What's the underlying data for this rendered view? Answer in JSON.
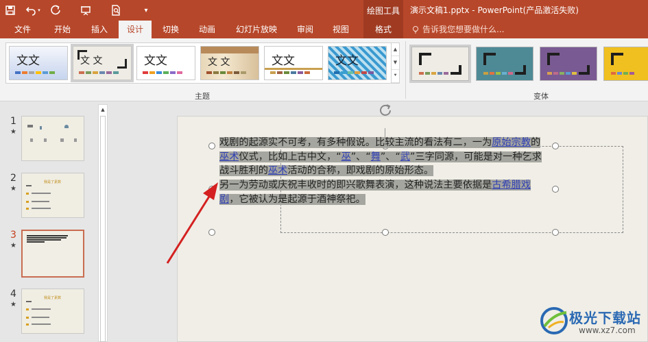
{
  "title_bar": {
    "context_tools": "绘图工具",
    "document_title": "演示文稿1.pptx - PowerPoint(产品激活失败)"
  },
  "tabs": [
    {
      "label": "文件",
      "active": false
    },
    {
      "label": "开始",
      "active": false
    },
    {
      "label": "插入",
      "active": false
    },
    {
      "label": "设计",
      "active": true
    },
    {
      "label": "切换",
      "active": false
    },
    {
      "label": "动画",
      "active": false
    },
    {
      "label": "幻灯片放映",
      "active": false
    },
    {
      "label": "审阅",
      "active": false
    },
    {
      "label": "视图",
      "active": false
    },
    {
      "label": "格式",
      "active": false
    }
  ],
  "tell_me": "告诉我您想要做什么...",
  "ribbon": {
    "themes_group_label": "主题",
    "variants_group_label": "变体",
    "theme_sample_text": "文文",
    "theme_sample_text_spaced": "文 文"
  },
  "slides": [
    {
      "number": "1"
    },
    {
      "number": "2",
      "title": "我是了素数"
    },
    {
      "number": "3"
    },
    {
      "number": "4",
      "title": "我是了素数"
    }
  ],
  "slide_text": {
    "p1_a": "戏剧的起源实不可考，有多种假说。比较主流的看法有二，一为",
    "p1_link1": "原始宗教",
    "p1_b": "的",
    "p1_link2": "巫术",
    "p1_c": "仪式，比如上古中文，“",
    "p1_link3": "巫",
    "p1_d": "”、“",
    "p1_link4": "舞",
    "p1_e": "”、“",
    "p1_link5": "武",
    "p1_f": "”三字同源，可能是对一种乞求战斗胜利的",
    "p1_link6": "巫术",
    "p1_g": "活动的合称，即戏剧的原始形态。",
    "p2_a": "另一为劳动或庆祝丰收时的即兴歌舞表演，这种说法主要依据是",
    "p2_link1": "古希腊戏剧",
    "p2_b": "，它被认为是起源于酒神祭祀。"
  },
  "watermark": {
    "name": "极光下载站",
    "url": "www.xz7.com"
  },
  "colors": {
    "accent": "#b7472a",
    "ribbon_bg": "#f3f3f3",
    "selection": "#a6a6a0",
    "hyperlink": "#2f3fb4",
    "arrow": "#d42020"
  }
}
